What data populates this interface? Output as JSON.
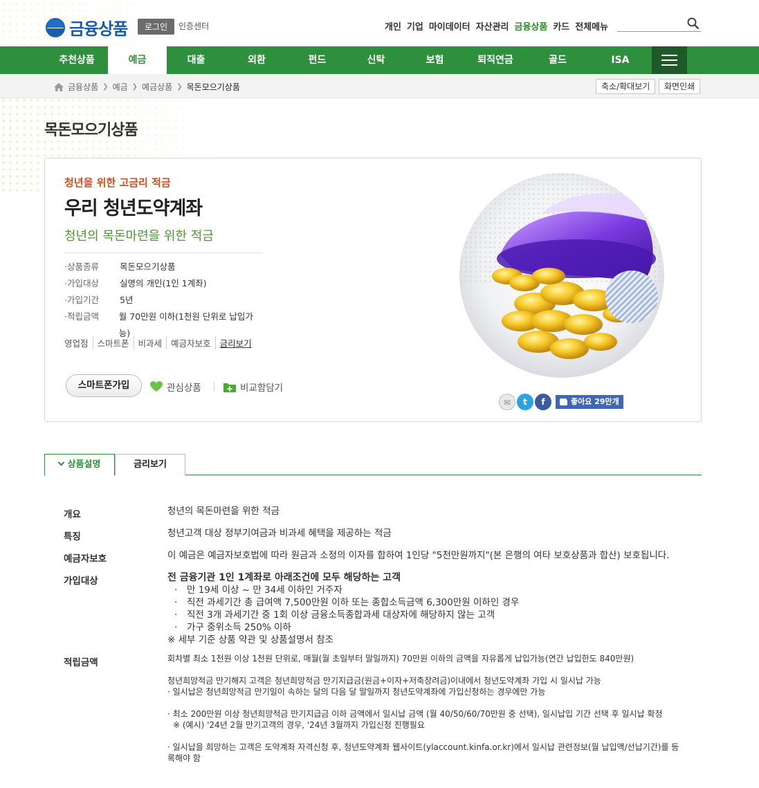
{
  "header": {
    "logo_text": "금융상품",
    "login_label": "로그인",
    "cert_label": "인증센터",
    "top_nav": [
      "개인",
      "기업",
      "마이데이터",
      "자산관리",
      "금융상품",
      "카드",
      "전체메뉴"
    ],
    "top_nav_active": "금융상품",
    "search_placeholder": ""
  },
  "gnb": {
    "items": [
      "추천상품",
      "예금",
      "대출",
      "외환",
      "펀드",
      "신탁",
      "보험",
      "퇴직연금",
      "골드",
      "ISA"
    ],
    "active": "예금"
  },
  "breadcrumb": {
    "items": [
      "금융상품",
      "예금",
      "예금상품",
      "목돈모으기상품"
    ]
  },
  "tools": {
    "zoom_label": "축소/확대보기",
    "print_label": "화면인쇄"
  },
  "page_title": "목돈모으기상품",
  "product": {
    "kicker": "청년을 위한 고금리 적금",
    "name": "우리 청년도약계좌",
    "subtitle": "청년의 목돈마련을 위한 적금",
    "specs": [
      {
        "key": "·상품종류",
        "value": "목돈모으기상품"
      },
      {
        "key": "·가입대상",
        "value": "실명의 개인(1인 1계좌)"
      },
      {
        "key": "·가입기간",
        "value": "5년"
      },
      {
        "key": "·적립금액",
        "value": "월 70만원 이하(1천원 단위로 납입가능)"
      }
    ],
    "links": [
      "영업점",
      "스마트폰",
      "비과세",
      "예금자보호",
      "금리보기"
    ],
    "smart_join_label": "스마트폰가입",
    "fav_label": "관심상품",
    "compare_label": "비교함담기",
    "like_label": "좋아요 29만개"
  },
  "tabs": [
    "상품설명",
    "금리보기"
  ],
  "description": {
    "overview_label": "개요",
    "overview": "청년의 목돈마련을 위한 적금",
    "feature_label": "특징",
    "feature": "청년고객 대상 정부기여금과 비과세 혜택을 제공하는 적금",
    "protect_label": "예금자보호",
    "protect": "이 예금은 예금자보호법에 따라 원금과 소정의 이자를 합하여 1인당 \"5천만원까지\"(본 은행의 여타 보호상품과 합산) 보호됩니다.",
    "target_label": "가입대상",
    "target_head": "전 금융기관 1인 1계좌로 아래조건에 모두 해당하는 고객",
    "target_items": [
      "만 19세 이상 ~ 만 34세 이하인 거주자",
      "직전 과세기간 총 급여액 7,500만원 이하 또는 종합소득금액 6,300만원 이하인 경우",
      "직전 3개 과세기간 중 1회 이상 금융소득종합과세 대상자에 해당하지 않는 고객",
      "가구 중위소득 250% 이하"
    ],
    "target_note": "※ 세부 기준 상품 약관 및 상품설명서 참조",
    "amount_label": "적립금액",
    "amount_line1": "회차별 최소 1천원 이상 1천원 단위로, 매월(월 초일부터 말일까지) 70만원 이하의 금액을 자유롭게 납입가능(연간 납입한도 840만원)",
    "amount_line2": "청년희망적금 만기해지 고객은 청년희망적금 만기지급금(원금+이자+저축장려금)이내에서 청년도약계좌 가입 시 일시납 가능",
    "amount_line3": "· 일시납은 청년희망적금 만기일이 속하는 달의 다음 달 말일까지 청년도약계좌에 가입신청하는 경우에만 가능",
    "amount_line4": "· 최소 200만원 이상 청년희망적금 만기지급금 이하 금액에서 일시납 금액 (월 40/50/60/70만원 중 선택), 일시납입 기간 선택 후 일시납 확정",
    "amount_line5": "※ (예시) '24년 2월 만기고객의 경우, '24년 3월까지 가입신청 진행필요",
    "amount_line6": "· 일시납을 희망하는 고객은 도약계좌 자격신청 후, 청년도약계좌 웹사이트(ylaccount.kinfa.or.kr)에서 일시납 관련정보(월 납입액/선납기간)를 등록해야 함"
  },
  "colors": {
    "brand_green": "#2e8f3c",
    "brand_blue": "#1a5aa8",
    "kicker_orange": "#d24e1d"
  }
}
